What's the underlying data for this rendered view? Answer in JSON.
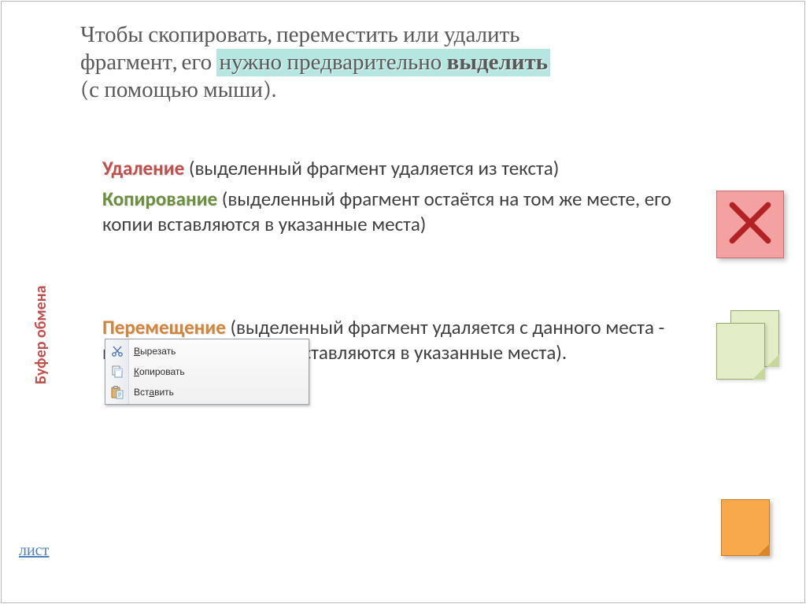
{
  "title": {
    "line1": "Чтобы скопировать, переместить или удалить",
    "line2_a": "фрагмент, его ",
    "highlight_a": "нужно предварительно ",
    "highlight_bold": "выделить",
    "line3": "(с помощью мыши)."
  },
  "sections": {
    "delete": {
      "term": "Удаление",
      "text": " (выделенный фрагмент удаляется из текста)"
    },
    "copy": {
      "term": "Копирование",
      "text": " (выделенный фрагмент остаётся на том же месте,  его копии вставляются в указанные места)"
    },
    "move": {
      "term": "Перемещение",
      "text": " (выделенный фрагмент удаляется с данного места -  вырезается, его копии вставляются в указанные места)."
    }
  },
  "context_menu": {
    "cut": {
      "u": "В",
      "rest": "ырезать"
    },
    "copy": {
      "u": "К",
      "rest": "опировать"
    },
    "paste": {
      "pre": "Вст",
      "u": "а",
      "rest": "вить"
    }
  },
  "sidebar": {
    "clipboard_label": "Буфер обмена",
    "sheet_link": "лист"
  },
  "icons": {
    "delete_x": "close-x",
    "cut": "scissors",
    "copy": "copy-sheets",
    "paste": "clipboard-paste"
  },
  "colors": {
    "accent_red": "#c0504d",
    "accent_green": "#6a8f3f",
    "accent_orange": "#d2863c",
    "title_highlight": "#b5e6e0"
  }
}
